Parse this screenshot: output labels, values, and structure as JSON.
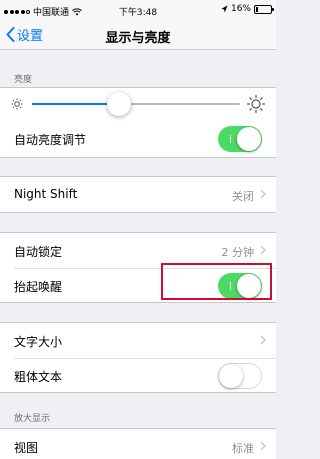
{
  "status_bar": {
    "carrier": "中国联通",
    "time": "下午3:48",
    "battery_text": "16%",
    "battery_level": 0.16
  },
  "nav": {
    "back_label": "设置",
    "title": "显示与亮度"
  },
  "brightness": {
    "section_header": "亮度",
    "level": 0.42,
    "auto_label": "自动亮度调节",
    "auto_on": true
  },
  "night_shift": {
    "label": "Night Shift",
    "value": "关闭"
  },
  "lock": {
    "auto_lock_label": "自动锁定",
    "auto_lock_value": "2 分钟",
    "raise_to_wake_label": "抬起唤醒",
    "raise_to_wake_on": true
  },
  "text": {
    "text_size_label": "文字大小",
    "bold_text_label": "粗体文本",
    "bold_on": false
  },
  "zoom": {
    "section_header": "放大显示",
    "view_label": "视图",
    "view_value": "标准"
  },
  "colors": {
    "accent": "#007aff",
    "toggle_on": "#4cd964",
    "highlight": "#c8102e"
  }
}
